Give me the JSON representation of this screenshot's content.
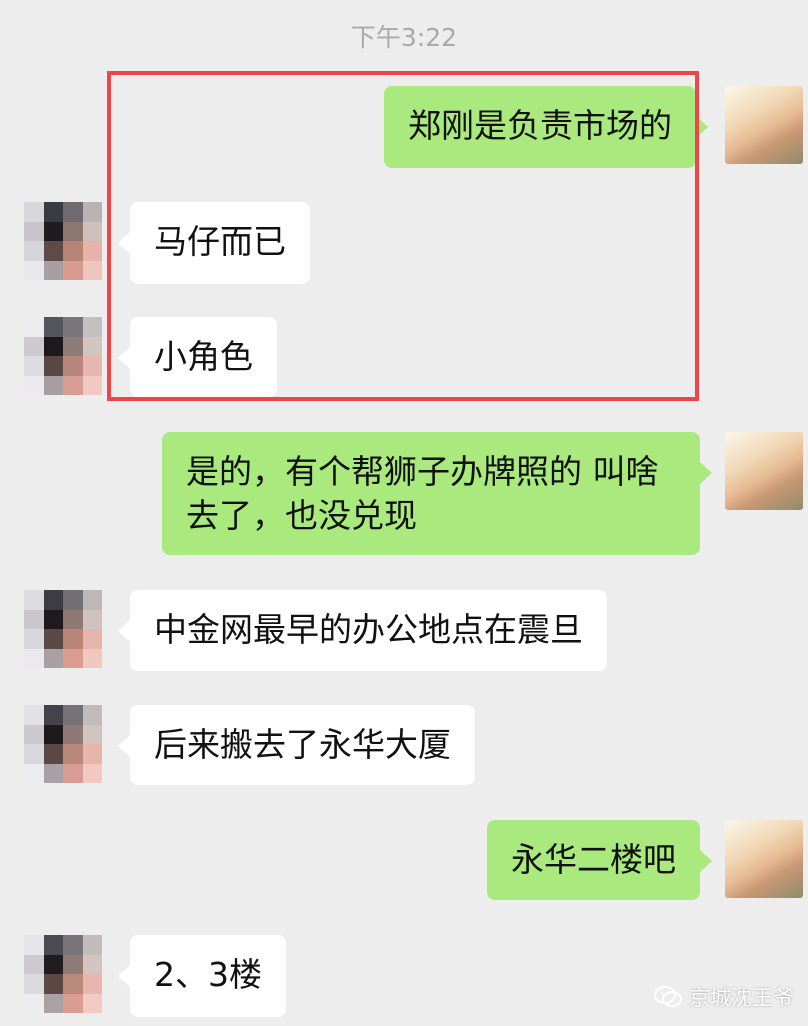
{
  "timestamp": "下午3:22",
  "messages": [
    {
      "side": "right",
      "text": "郑刚是负责市场的"
    },
    {
      "side": "left",
      "text": "马仔而已"
    },
    {
      "side": "left",
      "text": "小角色"
    },
    {
      "side": "right",
      "line1": "是的，有个帮狮子办牌照的 叫啥",
      "line2": "去了，也没兑现"
    },
    {
      "side": "left",
      "text": "中金网最早的办公地点在震旦"
    },
    {
      "side": "left",
      "text": "后来搬去了永华大厦"
    },
    {
      "side": "right",
      "text": "永华二楼吧"
    },
    {
      "side": "left",
      "text": "2、3楼"
    }
  ],
  "watermark": "京城沈王爷",
  "colors": {
    "background": "#ededed",
    "bubble_self": "#a9e97d",
    "bubble_other": "#ffffff",
    "highlight": "#f04548",
    "timestamp": "#a9a9a9"
  },
  "icons": {
    "self_avatar": "anime-character-avatar",
    "other_avatar": "pixelated-avatar",
    "watermark": "wechat-icon"
  }
}
